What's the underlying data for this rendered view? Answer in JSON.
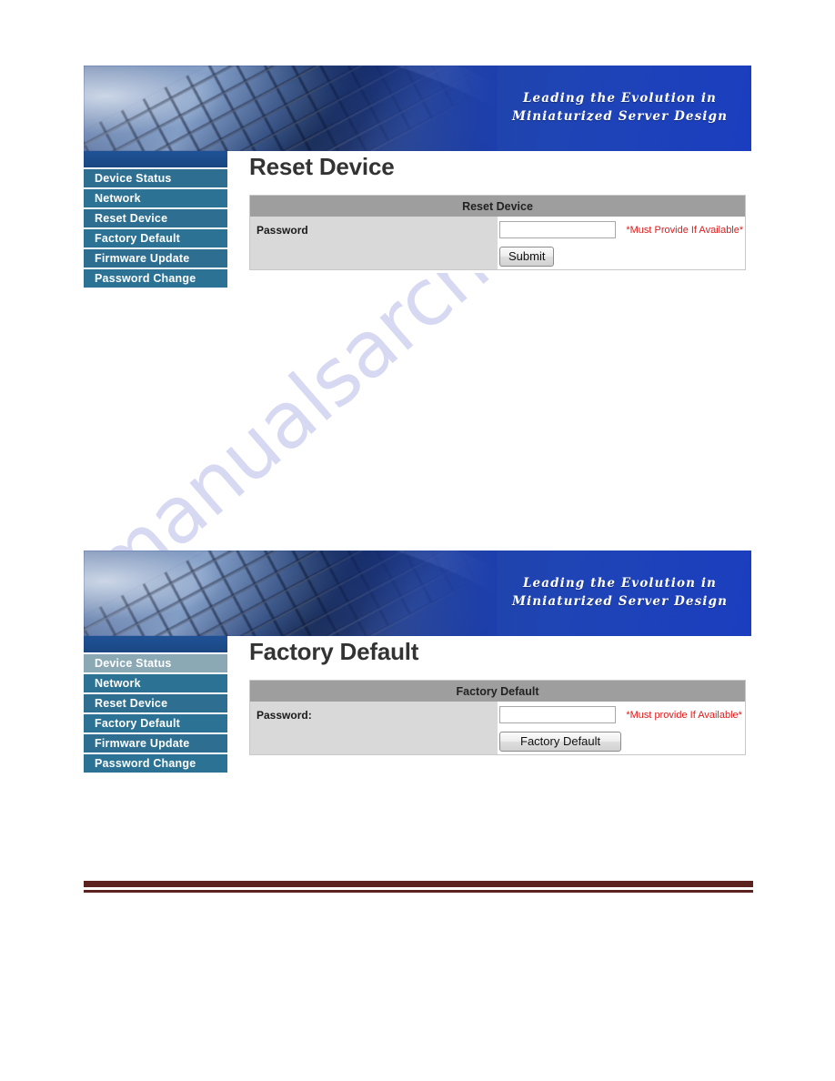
{
  "banner": {
    "tagline_line1": "Leading the Evolution in",
    "tagline_line2": "Miniaturized Server Design"
  },
  "watermark": {
    "text": "manualsarchive.com"
  },
  "sidebar": {
    "items": [
      {
        "label": "Device Status"
      },
      {
        "label": "Network"
      },
      {
        "label": "Reset Device"
      },
      {
        "label": "Factory Default"
      },
      {
        "label": "Firmware Update"
      },
      {
        "label": "Password Change"
      }
    ]
  },
  "sections": [
    {
      "title": "Reset Device",
      "table_header": "Reset Device",
      "password_label": "Password",
      "password_value": "",
      "hint": "*Must Provide If Available*",
      "action_label": "Submit"
    },
    {
      "title": "Factory Default",
      "table_header": "Factory Default",
      "password_label": "Password:",
      "password_value": "",
      "hint": "*Must provide If Available*",
      "action_label": "Factory Default"
    }
  ],
  "colors": {
    "banner_blue": "#1d3fae",
    "sidebar_header": "#1c4f8f",
    "nav_teal": "#2e6f91",
    "nav_highlight": "#8ba9b4",
    "table_header_gray": "#9e9e9e",
    "table_label_gray": "#d9d9d9",
    "hint_red": "#e01b1b",
    "footer_maroon": "#5b2220"
  }
}
